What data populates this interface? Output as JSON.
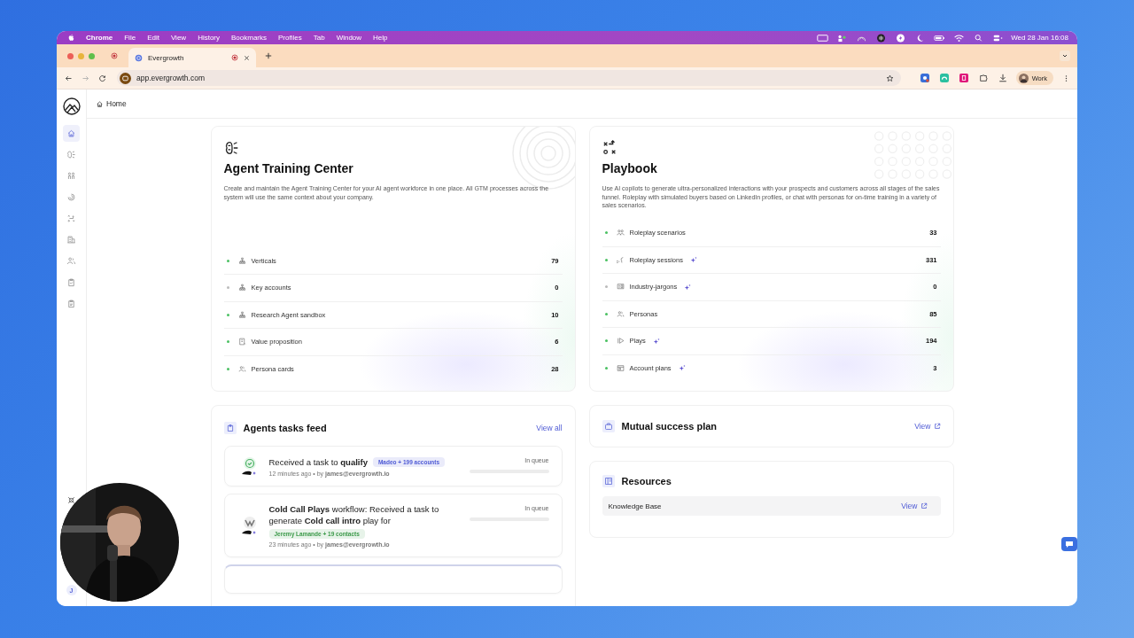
{
  "menubar": {
    "app_name": "Chrome",
    "menus": [
      "File",
      "Edit",
      "View",
      "History",
      "Bookmarks",
      "Profiles",
      "Tab",
      "Window",
      "Help"
    ],
    "clock": "Wed 28 Jan 16:08"
  },
  "tabs": [
    {
      "title": "Evergrowth",
      "selected": true
    }
  ],
  "address_bar": {
    "url": "app.evergrowth.com",
    "profile": "Work"
  },
  "sidebar": {
    "items": [
      {
        "selected": true
      },
      {
        "selected": false
      },
      {
        "selected": false
      },
      {
        "selected": false
      },
      {
        "selected": false
      },
      {
        "selected": false
      },
      {
        "selected": false
      },
      {
        "selected": false
      },
      {
        "selected": false
      }
    ],
    "user_initial": "J"
  },
  "breadcrumb": "Home",
  "training_center": {
    "title": "Agent Training Center",
    "description": "Create and maintain the Agent Training Center for your AI agent workforce in one place. All GTM processes across the system will use the same context about your company.",
    "items": [
      {
        "label": "Verticals",
        "count": "79",
        "active": true,
        "ai": false
      },
      {
        "label": "Key accounts",
        "count": "0",
        "active": false,
        "ai": false
      },
      {
        "label": "Research Agent sandbox",
        "count": "10",
        "active": true,
        "ai": false
      },
      {
        "label": "Value proposition",
        "count": "6",
        "active": true,
        "ai": false
      },
      {
        "label": "Persona cards",
        "count": "28",
        "active": true,
        "ai": false
      }
    ]
  },
  "playbook": {
    "title": "Playbook",
    "description": "Use AI copilots to generate ultra-personalized interactions with your prospects and customers across all stages of the sales funnel. Roleplay with simulated buyers based on LinkedIn profiles, or chat with personas for on-time training in a variety of sales scenarios.",
    "items": [
      {
        "label": "Roleplay scenarios",
        "count": "33",
        "active": true,
        "ai": false
      },
      {
        "label": "Roleplay sessions",
        "count": "331",
        "active": true,
        "ai": true
      },
      {
        "label": "Industry-jargons",
        "count": "0",
        "active": false,
        "ai": true
      },
      {
        "label": "Personas",
        "count": "85",
        "active": true,
        "ai": false
      },
      {
        "label": "Plays",
        "count": "194",
        "active": true,
        "ai": true
      },
      {
        "label": "Account plans",
        "count": "3",
        "active": true,
        "ai": true
      }
    ]
  },
  "tasks_feed": {
    "title": "Agents tasks feed",
    "view_all": "View all",
    "tasks": [
      {
        "text": "Received a task to **qualify**",
        "tag": "Madeo + 199 accounts",
        "color": "#4f5bd5",
        "meta": "12 minutes ago • by **james@evergrowth.io**",
        "status": "In queue",
        "kind": "check"
      },
      {
        "text": "**Cold Call Plays** workflow: Received a task to generate **Cold call intro** play for",
        "tag": "Jeremy Lamande + 19 contacts",
        "color": "#3c9a4a",
        "meta": "23 minutes ago • by **james@evergrowth.io**",
        "status": "In queue",
        "kind": "logo"
      }
    ]
  },
  "mutual_success_plan": {
    "title": "Mutual success plan",
    "link": "View"
  },
  "resources": {
    "title": "Resources",
    "items": [
      {
        "label": "Knowledge Base",
        "link": "View"
      }
    ]
  }
}
